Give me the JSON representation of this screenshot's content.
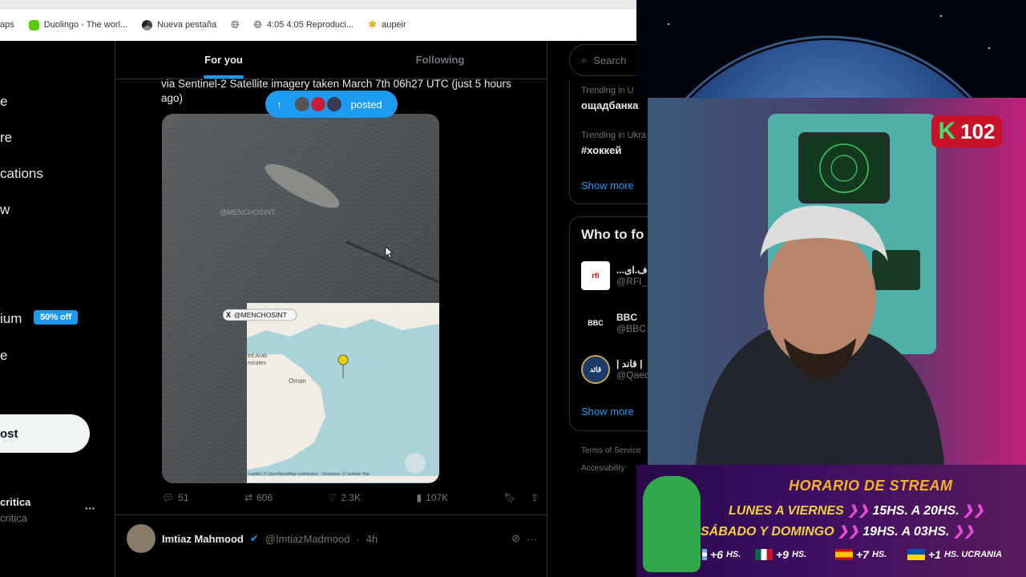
{
  "browser": {
    "bookmarks": [
      {
        "label": "aps",
        "icon": "apps-icon"
      },
      {
        "label": "Duolingo - The worl...",
        "icon": "duolingo-icon"
      },
      {
        "label": "Nueva pestaña",
        "icon": "chrome-icon"
      },
      {
        "label": "",
        "icon": "globe-icon"
      },
      {
        "label": "4:05 4:05 Reproduci...",
        "icon": "globe-icon"
      },
      {
        "label": "aupeir",
        "icon": "sparkle-icon"
      }
    ]
  },
  "nav": {
    "items": [
      "e",
      "re",
      "cations",
      "w"
    ],
    "premium_label": "ium",
    "premium_badge": "50% off",
    "profile_label": "e",
    "post_button": "ost",
    "user_name": "critica",
    "user_handle": "critica",
    "more": "···"
  },
  "feed": {
    "tabs": [
      {
        "label": "For you",
        "active": true
      },
      {
        "label": "Following",
        "active": false
      }
    ],
    "tweet_text": "via Sentinel-2 Satellite imagery taken March 7th 06h27 UTC (just 5 hours ago)",
    "posted_pill": "posted",
    "watermark": "@MENCHOSINT",
    "watermark_faint": "@MENCHOSINT",
    "map_labels": {
      "oman": "Oman",
      "uae_1": "ed Arab",
      "uae_2": "mirates",
      "attribution": "Leaflet | © OpenStreetMap contributors · Disclaimer, © Sentinel Hub"
    },
    "actions": {
      "replies": "51",
      "reposts": "606",
      "likes": "2.3K",
      "views": "107K"
    },
    "next_tweet": {
      "name": "Imtiaz Mahmood",
      "handle": "@ImtiazMadmood",
      "time": "4h",
      "sep": "·"
    }
  },
  "sidebar": {
    "search_placeholder": "Search",
    "trends": [
      {
        "label": "Trending in U",
        "title": "ощадбанка"
      },
      {
        "label": "Trending in Ukra",
        "title": "#хоккей"
      }
    ],
    "show_more": "Show more",
    "who_to_follow": "Who to fo",
    "accounts": [
      {
        "name": "...اف.ای",
        "handle": "@RFI_",
        "pic": "rfi"
      },
      {
        "name": "BBC",
        "handle": "@BBC",
        "pic": "BBC"
      },
      {
        "name": "| قاند |",
        "handle": "@Qaed",
        "pic": "قائد"
      }
    ],
    "show_more_2": "Show more",
    "footer": [
      "Terms of Service",
      "Accessibility"
    ]
  },
  "stream": {
    "counter_letter": "K",
    "counter_value": "102",
    "schedule_title": "HORARIO DE STREAM",
    "row1_days": "LUNES A VIERNES",
    "row1_from": "15",
    "row1_to": "20",
    "row2_days": "SÁBADO Y DOMINGO",
    "row2_from": "19",
    "row2_to": "03",
    "hs": "HS.",
    "a": "A",
    "timezones": [
      {
        "offset": "+6",
        "unit": "HS.",
        "flag": "argentina"
      },
      {
        "offset": "+9",
        "unit": "HS.",
        "flag": "mexico"
      },
      {
        "offset": "+7",
        "unit": "HS.",
        "flag": "spain"
      },
      {
        "offset": "+1",
        "unit": "HS. UCRANIA",
        "flag": "ukraine"
      }
    ]
  }
}
